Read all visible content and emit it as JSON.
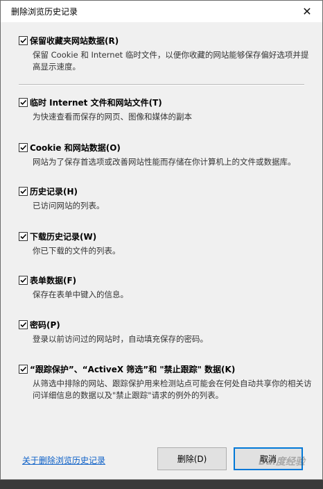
{
  "window": {
    "title": "删除浏览历史记录",
    "close_glyph": "✕"
  },
  "options": [
    {
      "label": "保留收藏夹网站数据(R)",
      "desc": "保留 Cookie 和 Internet 临时文件，以便你收藏的网站能够保存偏好选项并提高显示速度。",
      "checked": true
    },
    {
      "label": "临时 Internet 文件和网站文件(T)",
      "desc": "为快速查看而保存的网页、图像和媒体的副本",
      "checked": true
    },
    {
      "label": "Cookie 和网站数据(O)",
      "desc": "网站为了保存首选项或改善网站性能而存储在你计算机上的文件或数据库。",
      "checked": true
    },
    {
      "label": "历史记录(H)",
      "desc": "已访问网站的列表。",
      "checked": true
    },
    {
      "label": "下载历史记录(W)",
      "desc": "你已下载的文件的列表。",
      "checked": true
    },
    {
      "label": "表单数据(F)",
      "desc": "保存在表单中键入的信息。",
      "checked": true
    },
    {
      "label": "密码(P)",
      "desc": "登录以前访问过的网站时，自动填充保存的密码。",
      "checked": true
    },
    {
      "label": "“跟踪保护”、“ActiveX 筛选”和 \"禁止跟踪\" 数据(K)",
      "desc": "从筛选中排除的网站、跟踪保护用来检测站点可能会在何处自动共享你的相关访问详细信息的数据以及\"禁止跟踪\"请求的例外的列表。",
      "checked": true
    }
  ],
  "footer": {
    "link": "关于删除浏览历史记录",
    "delete_button": "删除(D)",
    "cancel_button": "取消"
  },
  "watermark": "Bai度经验"
}
